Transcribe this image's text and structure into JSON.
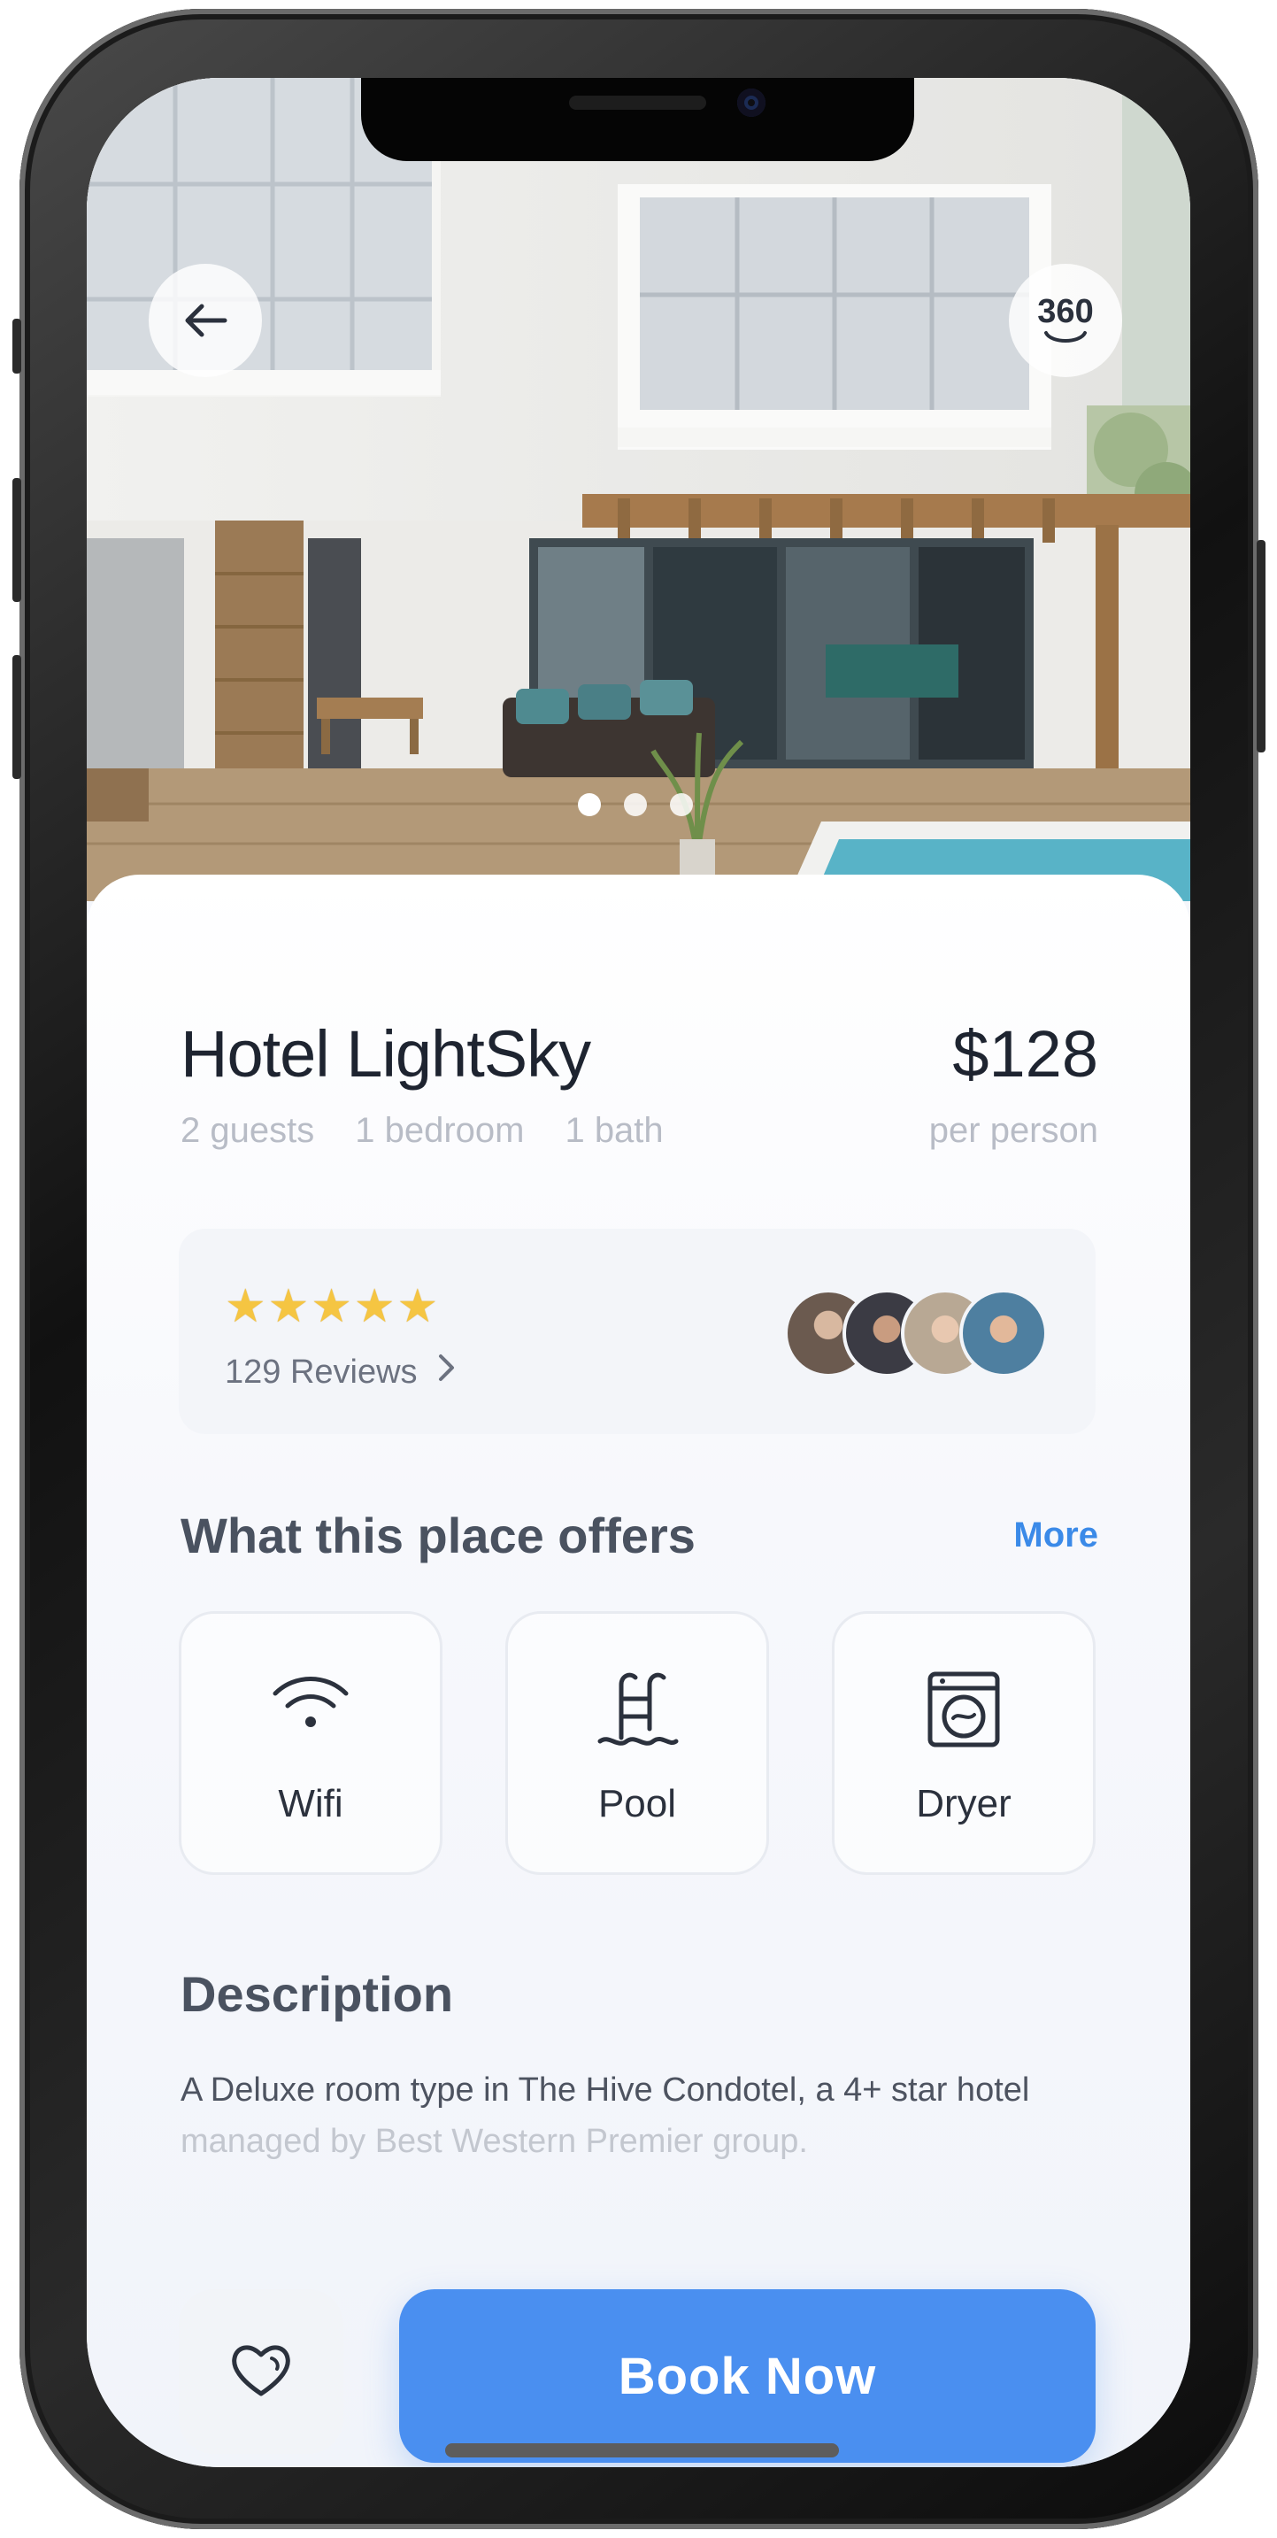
{
  "header": {
    "back_icon": "arrow-left-icon",
    "view_360_label": "360"
  },
  "carousel": {
    "image_count": 3,
    "active_index": 0
  },
  "listing": {
    "name": "Hotel LightSky",
    "price": "$128",
    "price_unit": "per person",
    "details": [
      "2 guests",
      "1 bedroom",
      "1 bath"
    ]
  },
  "reviews": {
    "rating_stars": 5,
    "count_label": "129 Reviews",
    "chevron_icon": "chevron-right-icon",
    "avatar_colors": [
      "#6b5a4f",
      "#3b3b44",
      "#b8a894",
      "#4e7fa0"
    ]
  },
  "amenities": {
    "heading": "What this place offers",
    "more_label": "More",
    "items": [
      {
        "label": "Wifi",
        "icon": "wifi-icon"
      },
      {
        "label": "Pool",
        "icon": "pool-icon"
      },
      {
        "label": "Dryer",
        "icon": "dryer-icon"
      }
    ]
  },
  "description": {
    "heading": "Description",
    "line1": "A Deluxe room type in The Hive Condotel, a 4+ star hotel",
    "line2": "managed by Best Western Premier group."
  },
  "actions": {
    "favorite_icon": "heart-icon",
    "book_label": "Book Now"
  },
  "colors": {
    "accent": "#4a8ff0",
    "text_primary": "#1e2430",
    "text_muted": "#b8bcc6",
    "star": "#f5c542"
  }
}
